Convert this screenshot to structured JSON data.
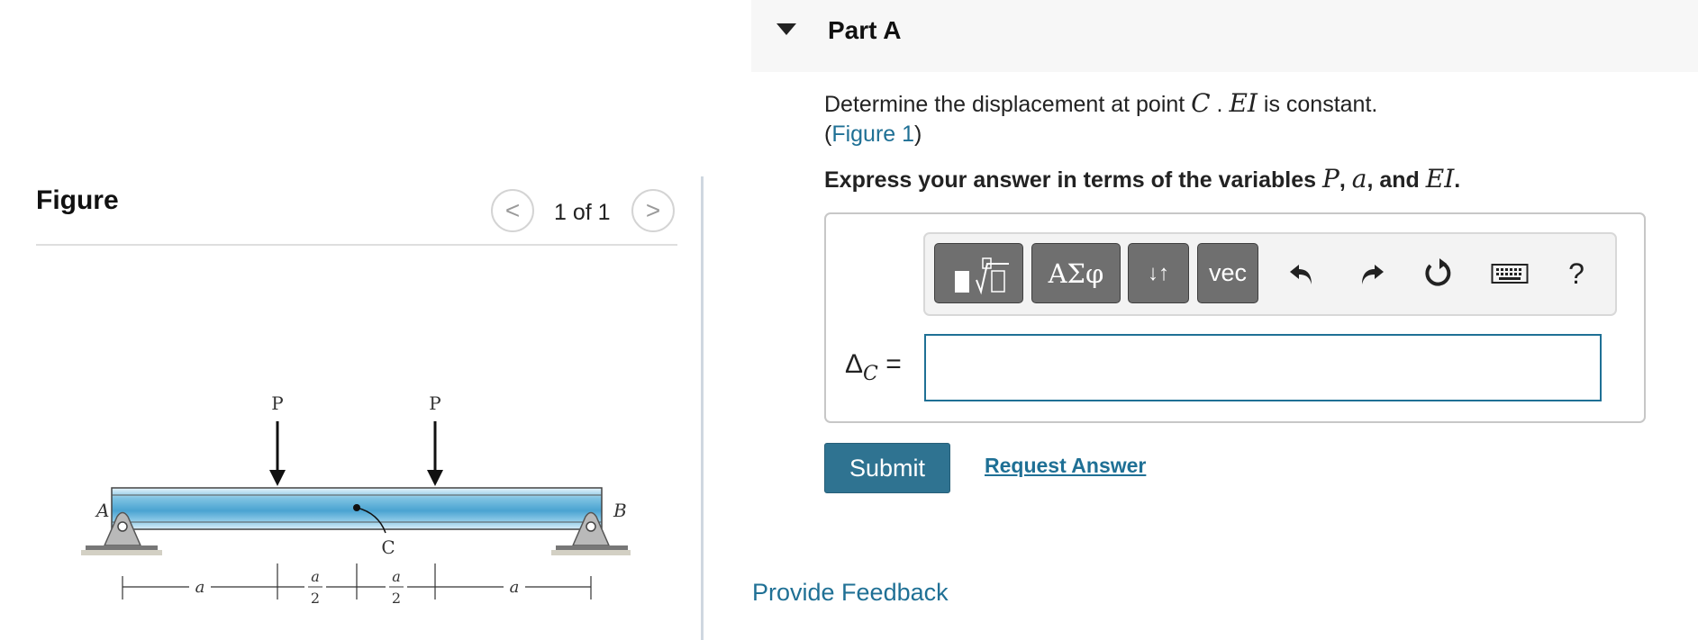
{
  "figure_panel": {
    "title": "Figure",
    "pagination": "1 of 1",
    "prev_label": "<",
    "next_label": ">",
    "diagram": {
      "load_label_left": "P",
      "load_label_right": "P",
      "support_left_label": "A",
      "support_right_label": "B",
      "point_label": "C",
      "dim_a_left": "a",
      "dim_half_num_1": "a",
      "dim_half_den_1": "2",
      "dim_half_num_2": "a",
      "dim_half_den_2": "2",
      "dim_a_right": "a"
    }
  },
  "part": {
    "title": "Part A",
    "question_prefix": "Determine the displacement at point ",
    "question_point": "C",
    "question_mid": " . ",
    "question_ei": "EI",
    "question_suffix": " is constant.",
    "figure_open": "(",
    "figure_link": "Figure 1",
    "figure_close": ")",
    "instruction_prefix": "Express your answer in terms of the variables ",
    "var_p": "P",
    "sep1": ", ",
    "var_a": "a",
    "sep2": ", and ",
    "var_ei": "EI",
    "instruction_end": "."
  },
  "toolbar": {
    "greek_label": "ΑΣφ",
    "arrows_label": "↓↑",
    "vec_label": "vec",
    "help_label": "?"
  },
  "answer": {
    "lhs_symbol": "Δ",
    "lhs_sub": "C",
    "equals": "=",
    "value": ""
  },
  "actions": {
    "submit_label": "Submit",
    "request_label": "Request Answer",
    "feedback_label": "Provide Feedback"
  },
  "colors": {
    "link": "#1f7095",
    "submit_bg": "#2f7391",
    "beam_blue": "#7fc3e3"
  }
}
